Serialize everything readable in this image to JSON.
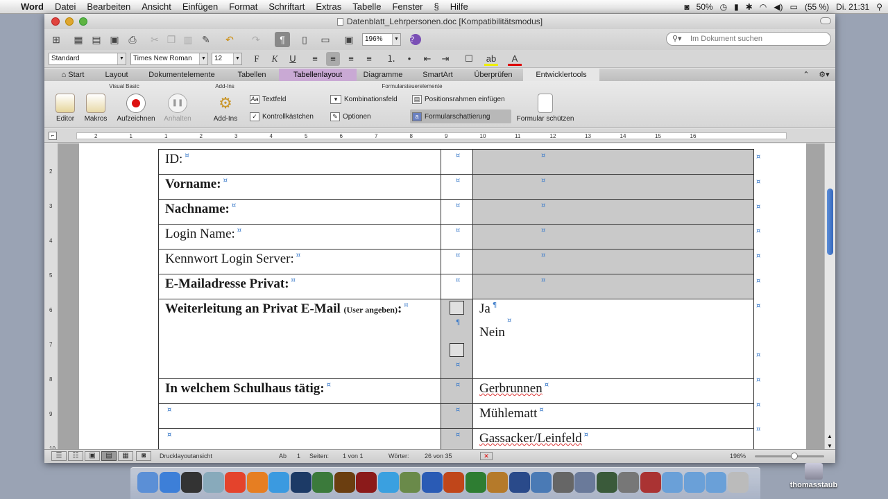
{
  "menubar": {
    "app": "Word",
    "items": [
      "Datei",
      "Bearbeiten",
      "Ansicht",
      "Einfügen",
      "Format",
      "Schriftart",
      "Extras",
      "Tabelle",
      "Fenster",
      "Hilfe"
    ],
    "battery": "50%",
    "battery2": "(55 %)",
    "clock": "Di. 21:31"
  },
  "window": {
    "title": "Datenblatt_Lehrpersonen.doc [Kompatibilitätsmodus]",
    "zoom": "196%",
    "search_placeholder": "Im Dokument suchen",
    "style": "Standard",
    "font": "Times New Roman",
    "size": "12"
  },
  "tabs": [
    "Start",
    "Layout",
    "Dokumentelemente",
    "Tabellen",
    "Tabellenlayout",
    "Diagramme",
    "SmartArt",
    "Überprüfen",
    "Entwicklertools"
  ],
  "ribbon": {
    "group_vb": "Visual Basic",
    "group_addins": "Add-Ins",
    "group_form": "Formularsteuerelemente",
    "editor": "Editor",
    "makros": "Makros",
    "aufzeichnen": "Aufzeichnen",
    "anhalten": "Anhalten",
    "addins": "Add-Ins",
    "textfeld": "Textfeld",
    "kontrollkaestchen": "Kontrollkästchen",
    "kombinationsfeld": "Kombinationsfeld",
    "optionen": "Optionen",
    "positionsrahmen": "Positionsrahmen einfügen",
    "formularschattierung": "Formularschattierung",
    "formular_schuetzen": "Formular schützen"
  },
  "ruler_numbers": [
    "2",
    "1",
    "1",
    "2",
    "3",
    "4",
    "5",
    "6",
    "7",
    "8",
    "9",
    "10",
    "11",
    "12",
    "13",
    "14",
    "15",
    "16"
  ],
  "vruler_numbers": [
    "2",
    "3",
    "4",
    "5",
    "6",
    "7",
    "8",
    "9",
    "10"
  ],
  "form": {
    "rows": [
      {
        "label": "ID:",
        "bold": false
      },
      {
        "label": "Vorname:",
        "bold": true
      },
      {
        "label": "Nachname:",
        "bold": true
      },
      {
        "label": "Login Name:",
        "bold": false
      },
      {
        "label": "Kennwort Login Server:",
        "bold": false
      },
      {
        "label": "E-Mailadresse Privat:",
        "bold": true
      }
    ],
    "forward_label": "Weiterleitung an Privat E-Mail",
    "forward_hint": "(User angeben)",
    "forward_colon": ":",
    "opt_yes": "Ja",
    "opt_no": "Nein",
    "school_label": "In welchem Schulhaus tätig:",
    "schools": [
      "Gerbrunnen",
      "Mühlematt",
      "Gassacker/Leinfeld"
    ],
    "cell_mark": "¤",
    "para_mark": "¶"
  },
  "status": {
    "view": "Drucklayoutansicht",
    "ab_label": "Ab",
    "ab_value": "1",
    "seiten_label": "Seiten:",
    "seiten_value": "1 von 1",
    "woerter_label": "Wörter:",
    "woerter_value": "26 von 35",
    "zoom": "196%"
  },
  "dock": {
    "user": "thomasstaub"
  }
}
